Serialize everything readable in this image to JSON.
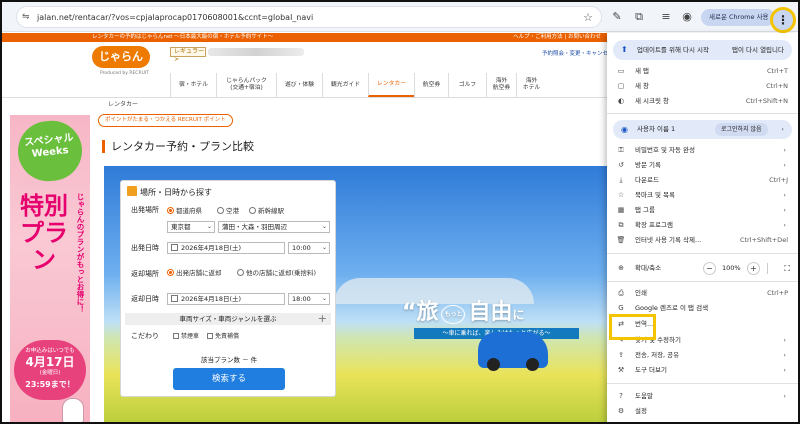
{
  "browser": {
    "url": "jalan.net/rentacar/?vos=cpjalaprocap0170608001&ccnt=global_navi",
    "new_chrome_label": "새로운 Chrome 사용 가",
    "menu_button": "⋮"
  },
  "site": {
    "top_strip_left": "レンタカーの予約はじゃらんnet 〜日本最大級の宿・ホテル予約サイト〜",
    "top_strip_right": "ヘルプ・ご利用方法 | お問い合わせ",
    "logo_text": "じゃらん",
    "logo_sub": "Produced by RECRUIT",
    "regular_badge": "レギュラー >",
    "reserve_link": "予約照会・変更・キャンセル",
    "nav": [
      {
        "label": "宿・ホテル"
      },
      {
        "label": "じゃらんパック\n(交通+宿泊)"
      },
      {
        "label": "遊び・体験"
      },
      {
        "label": "観光ガイド"
      },
      {
        "label": "レンタカー"
      },
      {
        "label": "航空券"
      },
      {
        "label": "ゴルフ"
      },
      {
        "label": "海外\n航空券"
      },
      {
        "label": "海外\nホテル"
      }
    ],
    "breadcrumb": "レンタカー",
    "point_tag": "ポイントがたまる・つかえる  RECRUIT ポイント",
    "page_title": "レンタカー予約・プラン比較",
    "banner": {
      "special": "スペシャル\nWeeks",
      "side_text": "じゃらんのプランがもっとお得に！",
      "big_text": "特別プラン",
      "until_label": "お申込みはいつでも",
      "until_date": "4月17日",
      "until_weekday": "(金曜日)",
      "until_time": "23:59まで！"
    },
    "hero": {
      "catch_left": "“旅",
      "catch_small": "もっと",
      "catch_right": "自由",
      "catch_end": "に",
      "catch_sub": "〜車に乗れば、楽しみはもっと広がる〜"
    },
    "form": {
      "title": "場所・日時から探す",
      "depart_place_label": "出発場所",
      "place_options": [
        "都道府県",
        "空港",
        "新幹線駅"
      ],
      "pref_value": "東京都",
      "area_value": "蒲田・大森・羽田周辺",
      "depart_time_label": "出発日時",
      "depart_date": "2026年4月18日(土)",
      "depart_time": "10:00",
      "return_place_label": "返却場所",
      "return_options": [
        "出発店舗に返却",
        "他の店舗に返却(乗捨料)"
      ],
      "return_time_label": "返却日時",
      "return_date": "2026年4月18日(土)",
      "return_time": "18:00",
      "vehicle_bar": "車両サイズ・車両ジャンルを選ぶ",
      "kodawari_label": "こだわり",
      "checks": [
        "禁煙車",
        "免責補償"
      ],
      "count_text": "該当プラン数 －  件",
      "search_button": "検索する"
    }
  },
  "menu": {
    "update_label": "업데이트를 위해 다시 시작",
    "update_action": "탭이 다시 열립니다",
    "items_top": [
      {
        "icon": "▭",
        "label": "새 탭",
        "shortcut": "Ctrl+T"
      },
      {
        "icon": "▢",
        "label": "새 창",
        "shortcut": "Ctrl+N"
      },
      {
        "icon": "◐",
        "label": "새 시크릿 창",
        "shortcut": "Ctrl+Shift+N"
      }
    ],
    "profile_label": "사용자 이름 1",
    "profile_status": "로그인하지 않음",
    "items_mid": [
      {
        "icon": "⚿",
        "label": "비밀번호 및 자동 완성",
        "arrow": "›"
      },
      {
        "icon": "↺",
        "label": "방문 기록",
        "arrow": "›"
      },
      {
        "icon": "⤓",
        "label": "다운로드",
        "shortcut": "Ctrl+J"
      },
      {
        "icon": "☆",
        "label": "북마크 및 목록",
        "arrow": "›"
      },
      {
        "icon": "▦",
        "label": "탭 그룹",
        "arrow": "›"
      },
      {
        "icon": "⧉",
        "label": "확장 프로그램",
        "arrow": "›"
      },
      {
        "icon": "🗑",
        "label": "인터넷 사용 기록 삭제...",
        "shortcut": "Ctrl+Shift+Del"
      }
    ],
    "zoom_label": "확대/축소",
    "zoom_minus": "−",
    "zoom_value": "100%",
    "zoom_plus": "+",
    "zoom_full": "⛶",
    "items_low": [
      {
        "icon": "⎙",
        "label": "인쇄",
        "shortcut": "Ctrl+P"
      },
      {
        "icon": "G",
        "label": "Google 렌즈로 이 탭 검색"
      },
      {
        "icon": "⇄",
        "label": "번역..."
      },
      {
        "icon": "✎",
        "label": "찾기 및 수정하기",
        "arrow": "›"
      },
      {
        "icon": "⇪",
        "label": "전송, 저장, 공유",
        "arrow": "›"
      },
      {
        "icon": "⚒",
        "label": "도구 더보기",
        "arrow": "›"
      }
    ],
    "items_bottom": [
      {
        "icon": "?",
        "label": "도움말",
        "arrow": "›"
      },
      {
        "icon": "⚙",
        "label": "설정"
      }
    ]
  },
  "colors": {
    "highlight": "#f5c400",
    "brand": "#eb6100",
    "search_button": "#1f7ee0"
  }
}
